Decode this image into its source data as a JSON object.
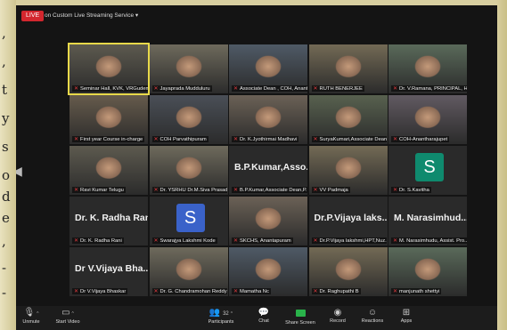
{
  "page_margin": {
    "left_chars": [
      ",",
      ",",
      "t",
      "y",
      "s",
      "o",
      "d",
      "e",
      ",",
      "-",
      "-"
    ]
  },
  "topbar": {
    "live_label": "LIVE",
    "stream_label": "on Custom Live Streaming Service"
  },
  "tiles": [
    {
      "id": "t1",
      "name": "Seminar Hall, KVK, VRGudem",
      "kind": "video",
      "active": true
    },
    {
      "id": "t2",
      "name": "Jayaprada Mudduluru",
      "kind": "video"
    },
    {
      "id": "t3",
      "name": "Associate Dean , COH, Anant...",
      "kind": "video"
    },
    {
      "id": "t4",
      "name": "RUTH BENERJEE",
      "kind": "video"
    },
    {
      "id": "t5",
      "name": "Dr. V.Ramana, PRINCIPAL, H...",
      "kind": "video"
    },
    {
      "id": "t6",
      "name": "First year Course in-charge",
      "kind": "video"
    },
    {
      "id": "t7",
      "name": "COH Parvathipuram",
      "kind": "video"
    },
    {
      "id": "t8",
      "name": "Dr. K.Jyothirmai Madhavi",
      "kind": "video"
    },
    {
      "id": "t9",
      "name": "SuryaKumari,Associate Dean,C...",
      "kind": "video"
    },
    {
      "id": "t10",
      "name": "COH-Anantharajupet",
      "kind": "video"
    },
    {
      "id": "t11",
      "name": "Ravi Kumar Telugu",
      "kind": "video"
    },
    {
      "id": "t12",
      "name": "Dr. YSRHU Dr.M.Siva Prasad",
      "kind": "video"
    },
    {
      "id": "t13",
      "name": "B.P.Kumar,Associate Dean,P...",
      "kind": "text",
      "big": "B.P.Kumar,Asso..."
    },
    {
      "id": "t14",
      "name": "VV Padmaja",
      "kind": "video"
    },
    {
      "id": "t15",
      "name": "Dr. S.Kavitha",
      "kind": "avatar",
      "letter": "S",
      "color": "#0f8a6e"
    },
    {
      "id": "t16",
      "name": "Dr. K. Radha Rani",
      "kind": "text",
      "big": "Dr. K. Radha Rani"
    },
    {
      "id": "t17",
      "name": "Swarajya Lakshmi Kode",
      "kind": "avatar",
      "letter": "S",
      "color": "#3a62c9"
    },
    {
      "id": "t18",
      "name": "SKCHS, Anantapuram",
      "kind": "video"
    },
    {
      "id": "t19",
      "name": "Dr.P.Vijaya lakshmi,HPT,Nuz...",
      "kind": "text",
      "big": "Dr.P.Vijaya laks..."
    },
    {
      "id": "t20",
      "name": "M. Narasimhudu, Assist. Pro...",
      "kind": "text",
      "big": "M. Narasimhud..."
    },
    {
      "id": "t21",
      "name": "Dr V.Vijaya Bhaskar",
      "kind": "text",
      "big": "Dr V.Vijaya Bha..."
    },
    {
      "id": "t22",
      "name": "Dr. G. Chandramohan Reddy",
      "kind": "video"
    },
    {
      "id": "t23",
      "name": "Mamatha Nc",
      "kind": "video"
    },
    {
      "id": "t24",
      "name": "Dr. Raghupathi B",
      "kind": "video"
    },
    {
      "id": "t25",
      "name": "manjunath shettyi",
      "kind": "video"
    }
  ],
  "toolbar": {
    "unmute": "Unmute",
    "start_video": "Start Video",
    "participants": "Participants",
    "participant_count": "32",
    "chat": "Chat",
    "share_screen": "Share Screen",
    "record": "Record",
    "reactions": "Reactions",
    "apps": "Apps"
  },
  "colors": {
    "mute_red": "#e0393e",
    "active_border": "#e8d94a",
    "share_green": "#29b34a",
    "live_red": "#d3272e"
  }
}
